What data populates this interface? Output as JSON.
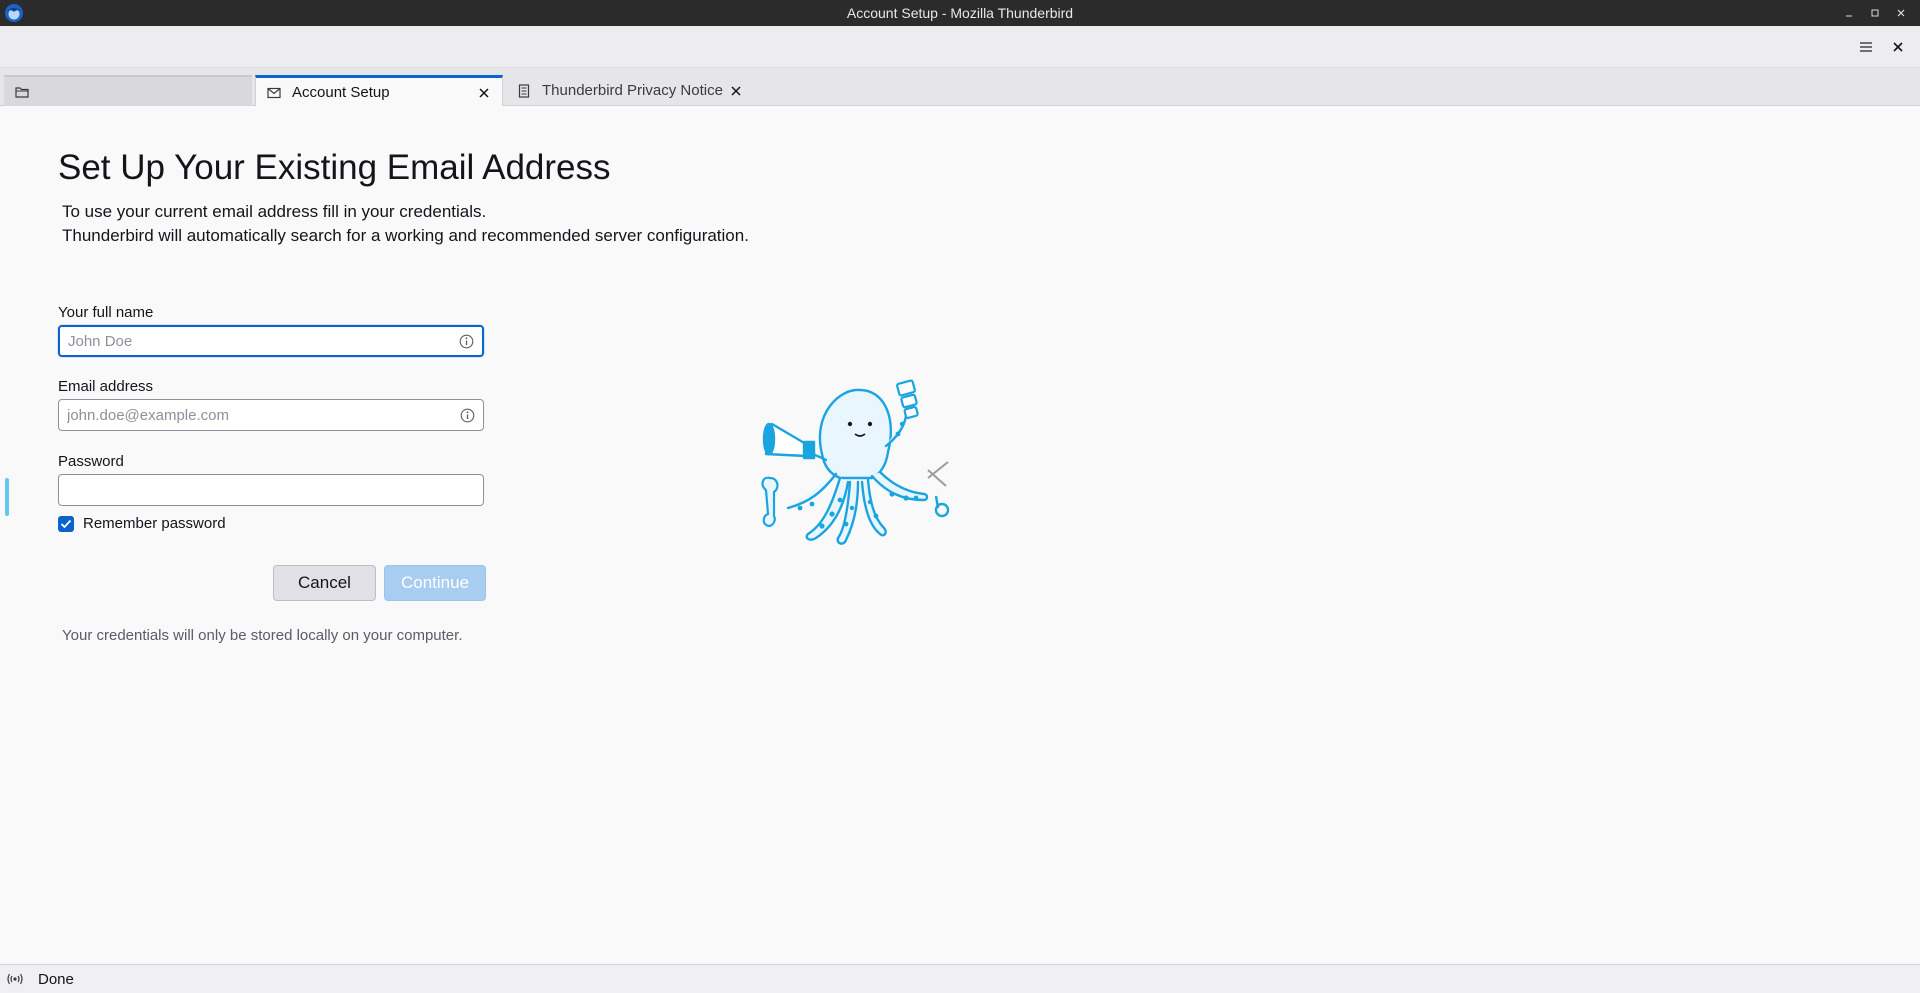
{
  "window": {
    "title": "Account Setup - Mozilla Thunderbird",
    "app_icon": "thunderbird-logo-icon"
  },
  "toolbar": {
    "menu_icon": "hamburger-menu-icon",
    "close_icon": "close-icon"
  },
  "tabs": [
    {
      "label": "",
      "icon": "folder-icon",
      "active": false
    },
    {
      "label": "Account Setup",
      "icon": "envelope-icon",
      "active": true
    },
    {
      "label": "Thunderbird Privacy Notice",
      "icon": "document-icon",
      "active": false
    }
  ],
  "page": {
    "title": "Set Up Your Existing Email Address",
    "description_line1": "To use your current email address fill in your credentials.",
    "description_line2": "Thunderbird will automatically search for a working and recommended server configuration."
  },
  "form": {
    "full_name_label": "Your full name",
    "full_name_placeholder": "John Doe",
    "email_label": "Email address",
    "email_placeholder": "john.doe@example.com",
    "password_label": "Password",
    "password_value": "",
    "remember_label": "Remember password",
    "remember_checked": true,
    "cancel_label": "Cancel",
    "continue_label": "Continue"
  },
  "note": "Your credentials will only be stored locally on your computer.",
  "status": {
    "text": "Done",
    "icon": "connection-icon"
  },
  "colors": {
    "accent": "#0b64ce",
    "continue_disabled": "#a9cdf0",
    "mascot": "#1aa4e0"
  }
}
